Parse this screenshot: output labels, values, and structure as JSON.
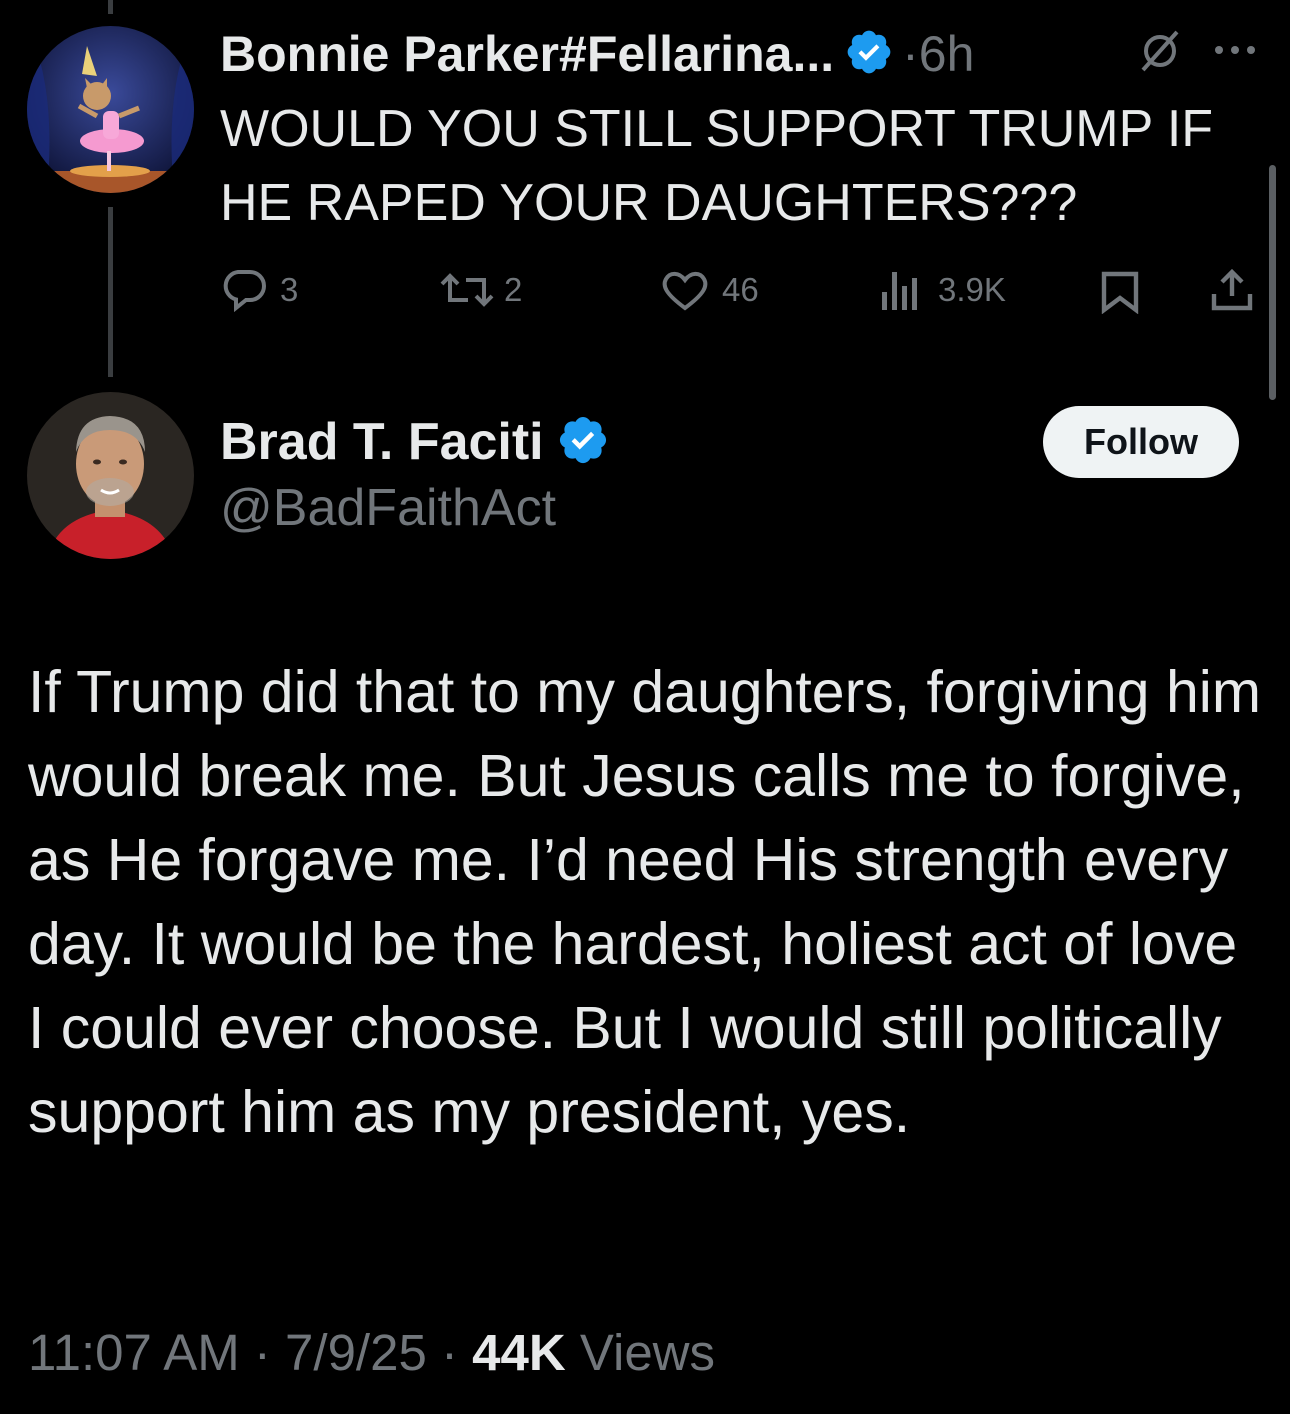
{
  "parent_tweet": {
    "display_name": "Bonnie Parker#Fellarina...",
    "separator": "·",
    "time": "6h",
    "text": "WOULD YOU STILL SUPPORT TRUMP IF HE RAPED YOUR DAUGHTERS???",
    "avatar_icon": "ballerina-cat-avatar",
    "actions": {
      "replies": "3",
      "reposts": "2",
      "likes": "46",
      "views": "3.9K"
    }
  },
  "main_tweet": {
    "display_name": "Brad T. Faciti",
    "handle": "@BadFaithAct",
    "follow_label": "Follow",
    "text": "If Trump did that to my daughters, forgiving him would break me. But Jesus calls me to forgive, as He forgave me. I’d need His strength every day. It would be the hardest, holiest act of love I could ever choose. But I would still politically support him as my president, yes.",
    "time": "11:07 AM",
    "sep1": " · ",
    "date": "7/9/25",
    "sep2": " · ",
    "views_count": "44K",
    "views_label": " Views",
    "avatar_icon": "man-portrait-avatar"
  },
  "colors": {
    "background": "#000000",
    "text": "#e7e9ea",
    "muted": "#71767b",
    "verified": "#1d9bf0"
  }
}
